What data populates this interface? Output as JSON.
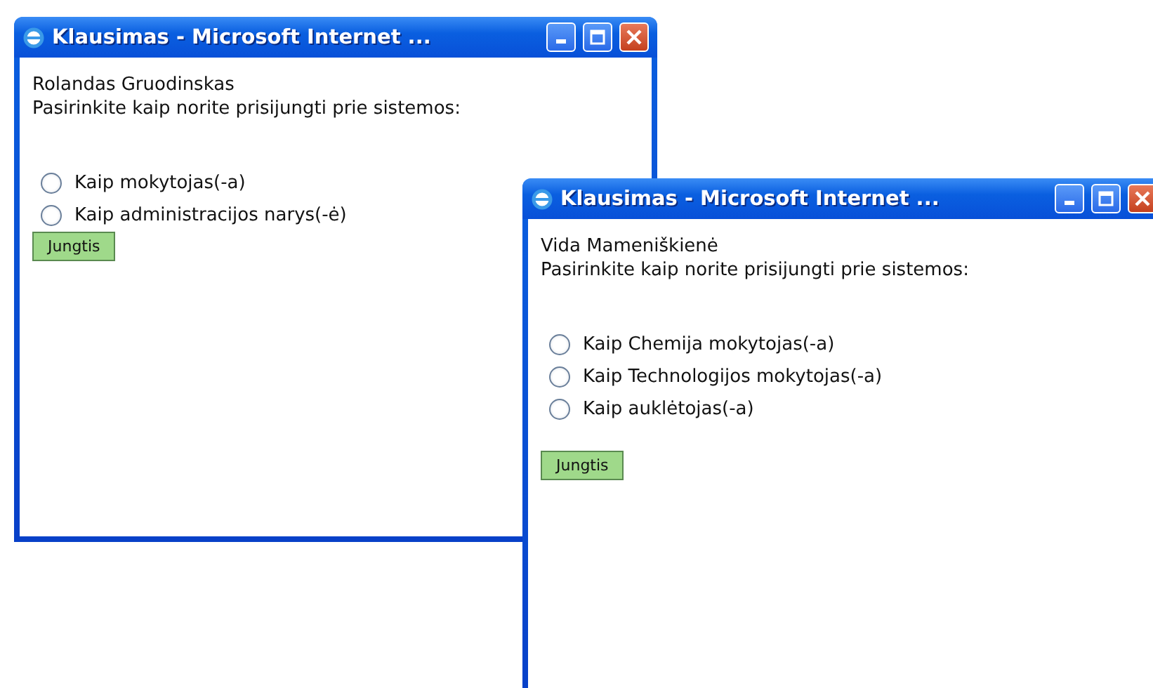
{
  "windows": [
    {
      "title": "Klausimas - Microsoft Internet ...",
      "user": "Rolandas Gruodinskas",
      "prompt": "Pasirinkite kaip norite prisijungti prie sistemos:",
      "options": [
        {
          "label": "Kaip mokytojas(-a)",
          "selected": false
        },
        {
          "label": "Kaip administracijos narys(-ė)",
          "selected": false
        }
      ],
      "button": "Jungtis"
    },
    {
      "title": "Klausimas - Microsoft Internet ...",
      "user": "Vida Mameniškienė",
      "prompt": "Pasirinkite kaip norite prisijungti prie sistemos:",
      "options": [
        {
          "label": "Kaip Chemija mokytojas(-a)",
          "selected": false
        },
        {
          "label": "Kaip Technologijos mokytojas(-a)",
          "selected": false
        },
        {
          "label": "Kaip auklėtojas(-a)",
          "selected": false
        }
      ],
      "button": "Jungtis"
    }
  ]
}
